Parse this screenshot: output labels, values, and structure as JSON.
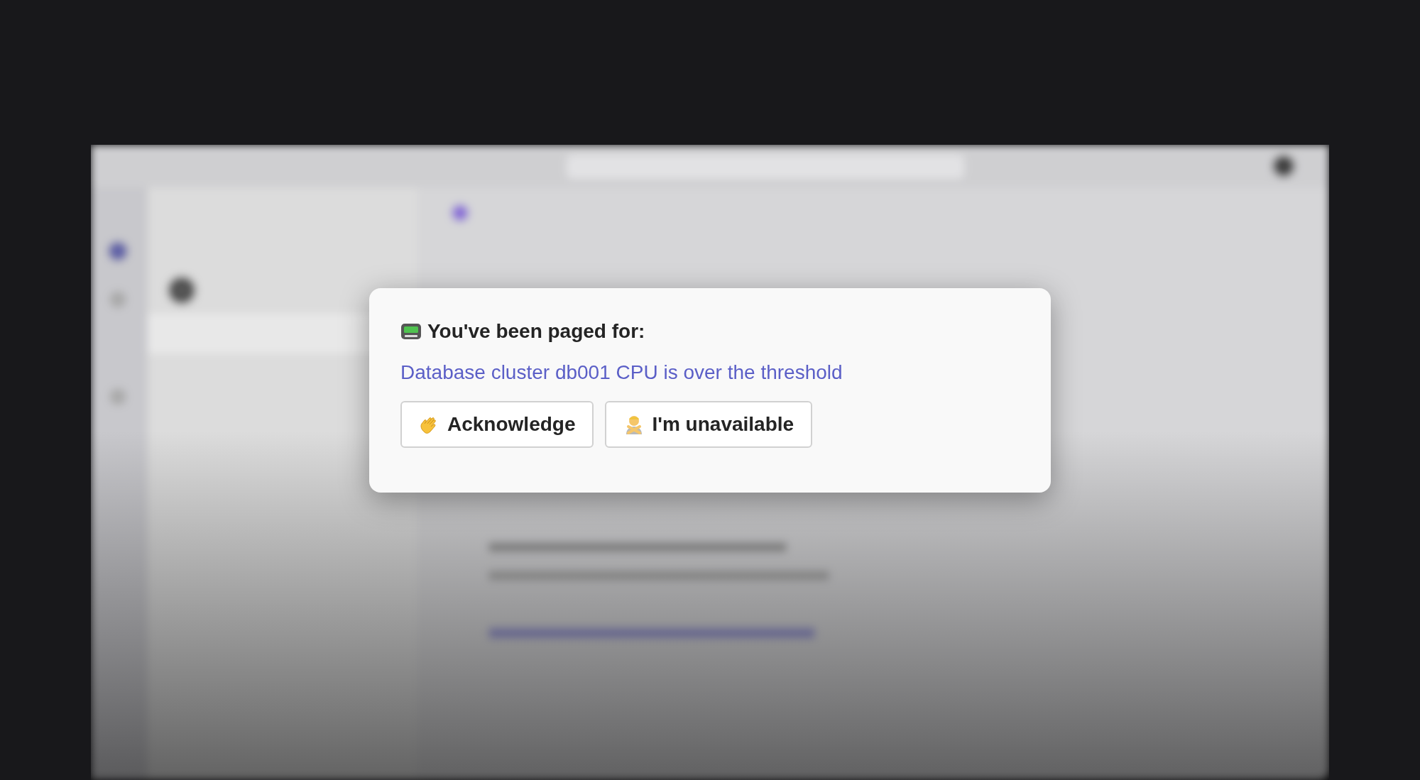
{
  "notification": {
    "title": "You've been paged for:",
    "alert_link": "Database cluster db001 CPU is over the threshold",
    "buttons": [
      {
        "label": "Acknowledge",
        "kind": "acknowledge"
      },
      {
        "label": "I'm unavailable",
        "kind": "unavailable"
      }
    ]
  }
}
